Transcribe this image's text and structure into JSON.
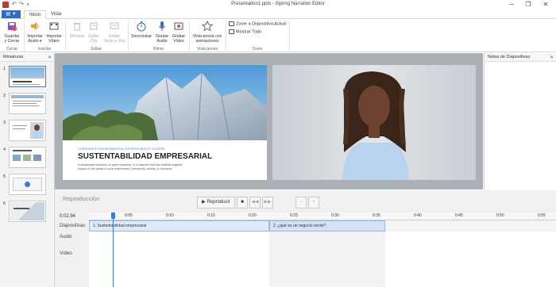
{
  "window": {
    "title": "Presentation1.pptx - iSpring Narration Editor",
    "controls": [
      "─",
      "❐",
      "✕"
    ]
  },
  "ribbon": {
    "menu_label": "▼",
    "tabs": [
      {
        "label": "Inicio",
        "active": true
      },
      {
        "label": "Vista",
        "active": false
      }
    ],
    "buttons": {
      "guardar": "Guardar\ny Cerrar",
      "importar_audio": "Importar\nAudio ▾",
      "importar_video": "Importar\nVídeo",
      "eliminar": "Eliminar",
      "editar_clip": "Editar\nClip",
      "editar_texto": "Editar\nTexto a Voz",
      "sincronizar": "Sincronizar",
      "grabar_audio": "Grabar\nAudio",
      "grabar_video": "Grabar\nVídeo",
      "vista_previa": "Vista previa con\nanimaciones",
      "zoom_diapositiva": "Zoom a Diapositiva Actual",
      "mostrar_todo": "Mostrar Todo"
    },
    "groups": {
      "cerrar": "Cerrar",
      "insertar": "Insertar",
      "editar": "Editar",
      "ritmo": "Ritmo",
      "vista_previa": "Vista previa",
      "zoom": "Zoom"
    }
  },
  "thumbnails": {
    "header": "Miniaturas",
    "items": [
      "1",
      "2",
      "3",
      "4",
      "5",
      "6"
    ]
  },
  "notes": {
    "header": "Notas de Diapositivas"
  },
  "slide": {
    "small_header": "CORPORATE ENVIRONMENTAL   RESPONSIBILITY   COURSE",
    "title": "SUSTENTABILIDAD EMPRESARIAL",
    "body": "A sustainable business, or green business, is a business that has minimal negative impact on the global or local environment, community, society, or economy."
  },
  "playback": {
    "title": "Reproducción",
    "play_label": "Reproducir",
    "current_time": "0:02.94",
    "ticks": [
      "0:05",
      "0:10",
      "0:15",
      "0:20",
      "0:25",
      "0:30",
      "0:35",
      "0:40",
      "0:45",
      "0:50",
      "0:55"
    ],
    "rows": {
      "slides": "Diapositivas",
      "audio": "Audio",
      "video": "Vídeo"
    },
    "clips": [
      {
        "label": "1. Sustentabilidad empresarial"
      },
      {
        "label": "2. ¿qué es un negocio verde?"
      }
    ]
  }
}
